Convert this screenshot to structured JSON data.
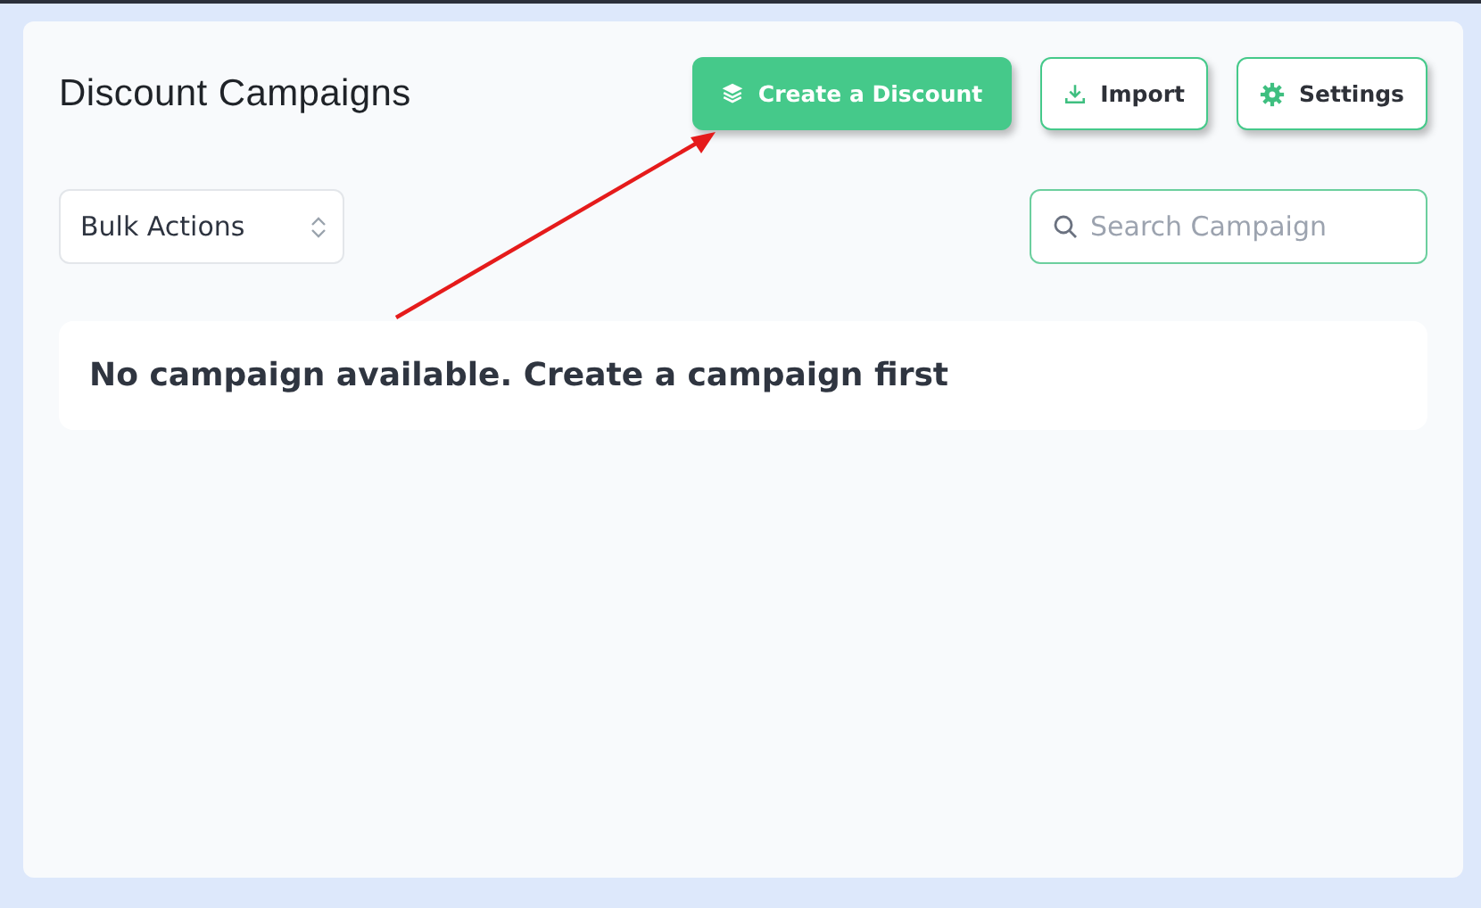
{
  "title": "Discount Campaigns",
  "buttons": [
    {
      "label": "Create a Discount",
      "kind": "primary"
    },
    {
      "label": "Import",
      "kind": "outline"
    },
    {
      "label": "Settings",
      "kind": "outline"
    }
  ],
  "bulk_actions": {
    "value": "Bulk Actions"
  },
  "search": {
    "placeholder": "Search Campaign"
  },
  "empty_message": "No campaign available. Create a campaign first"
}
